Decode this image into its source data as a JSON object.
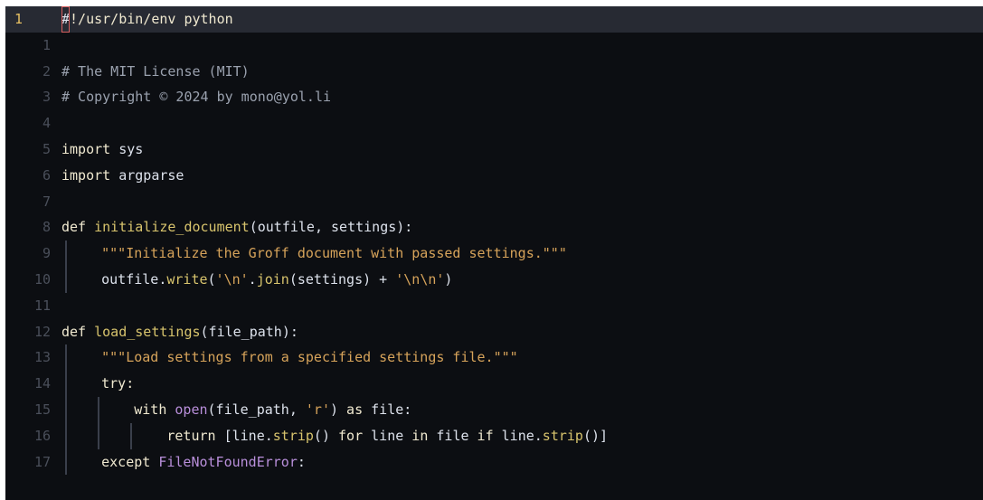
{
  "editor": {
    "current_line_number": "1",
    "lines": [
      {
        "n": "1",
        "current": true,
        "depth": 0,
        "tokens": [
          {
            "c": "cursor",
            "t": "#"
          },
          {
            "c": "kw",
            "t": "!/usr/bin/env python"
          }
        ]
      },
      {
        "n": "1",
        "depth": 0,
        "tokens": []
      },
      {
        "n": "2",
        "depth": 0,
        "tokens": [
          {
            "c": "cmt",
            "t": "# The MIT License (MIT)"
          }
        ]
      },
      {
        "n": "3",
        "depth": 0,
        "tokens": [
          {
            "c": "cmt",
            "t": "# Copyright © 2024 by mono@yol.li"
          }
        ]
      },
      {
        "n": "4",
        "depth": 0,
        "tokens": []
      },
      {
        "n": "5",
        "depth": 0,
        "tokens": [
          {
            "c": "kw",
            "t": "import "
          },
          {
            "c": "pun",
            "t": "sys"
          }
        ]
      },
      {
        "n": "6",
        "depth": 0,
        "tokens": [
          {
            "c": "kw",
            "t": "import "
          },
          {
            "c": "pun",
            "t": "argparse"
          }
        ]
      },
      {
        "n": "7",
        "depth": 0,
        "tokens": []
      },
      {
        "n": "8",
        "depth": 0,
        "tokens": [
          {
            "c": "kw",
            "t": "def "
          },
          {
            "c": "fn",
            "t": "initialize_document"
          },
          {
            "c": "pun",
            "t": "(outfile, settings):"
          }
        ]
      },
      {
        "n": "9",
        "depth": 1,
        "tokens": [
          {
            "c": "str",
            "t": "\"\"\"Initialize the Groff document with passed settings.\"\"\""
          }
        ]
      },
      {
        "n": "10",
        "depth": 1,
        "tokens": [
          {
            "c": "pun",
            "t": "outfile."
          },
          {
            "c": "fn",
            "t": "write"
          },
          {
            "c": "pun",
            "t": "("
          },
          {
            "c": "str",
            "t": "'\\n'"
          },
          {
            "c": "pun",
            "t": "."
          },
          {
            "c": "fn",
            "t": "join"
          },
          {
            "c": "pun",
            "t": "(settings) + "
          },
          {
            "c": "str",
            "t": "'\\n\\n'"
          },
          {
            "c": "pun",
            "t": ")"
          }
        ]
      },
      {
        "n": "11",
        "depth": 0,
        "tokens": []
      },
      {
        "n": "12",
        "depth": 0,
        "tokens": [
          {
            "c": "kw",
            "t": "def "
          },
          {
            "c": "fn",
            "t": "load_settings"
          },
          {
            "c": "pun",
            "t": "(file_path):"
          }
        ]
      },
      {
        "n": "13",
        "depth": 1,
        "tokens": [
          {
            "c": "str",
            "t": "\"\"\"Load settings from a specified settings file.\"\"\""
          }
        ]
      },
      {
        "n": "14",
        "depth": 1,
        "tokens": [
          {
            "c": "kw",
            "t": "try:"
          }
        ]
      },
      {
        "n": "15",
        "depth": 2,
        "tokens": [
          {
            "c": "kw",
            "t": "with "
          },
          {
            "c": "bi",
            "t": "open"
          },
          {
            "c": "pun",
            "t": "(file_path, "
          },
          {
            "c": "str",
            "t": "'r'"
          },
          {
            "c": "pun",
            "t": ") "
          },
          {
            "c": "kw",
            "t": "as "
          },
          {
            "c": "pun",
            "t": "file:"
          }
        ]
      },
      {
        "n": "16",
        "depth": 3,
        "tokens": [
          {
            "c": "kw",
            "t": "return "
          },
          {
            "c": "pun",
            "t": "[line."
          },
          {
            "c": "fn",
            "t": "strip"
          },
          {
            "c": "pun",
            "t": "() "
          },
          {
            "c": "kw",
            "t": "for "
          },
          {
            "c": "pun",
            "t": "line "
          },
          {
            "c": "kw",
            "t": "in "
          },
          {
            "c": "pun",
            "t": "file "
          },
          {
            "c": "kw",
            "t": "if "
          },
          {
            "c": "pun",
            "t": "line."
          },
          {
            "c": "fn",
            "t": "strip"
          },
          {
            "c": "pun",
            "t": "()]"
          }
        ]
      },
      {
        "n": "17",
        "depth": 1,
        "tokens": [
          {
            "c": "kw",
            "t": "except "
          },
          {
            "c": "bi",
            "t": "FileNotFoundError"
          },
          {
            "c": "pun",
            "t": ":"
          }
        ]
      }
    ]
  }
}
